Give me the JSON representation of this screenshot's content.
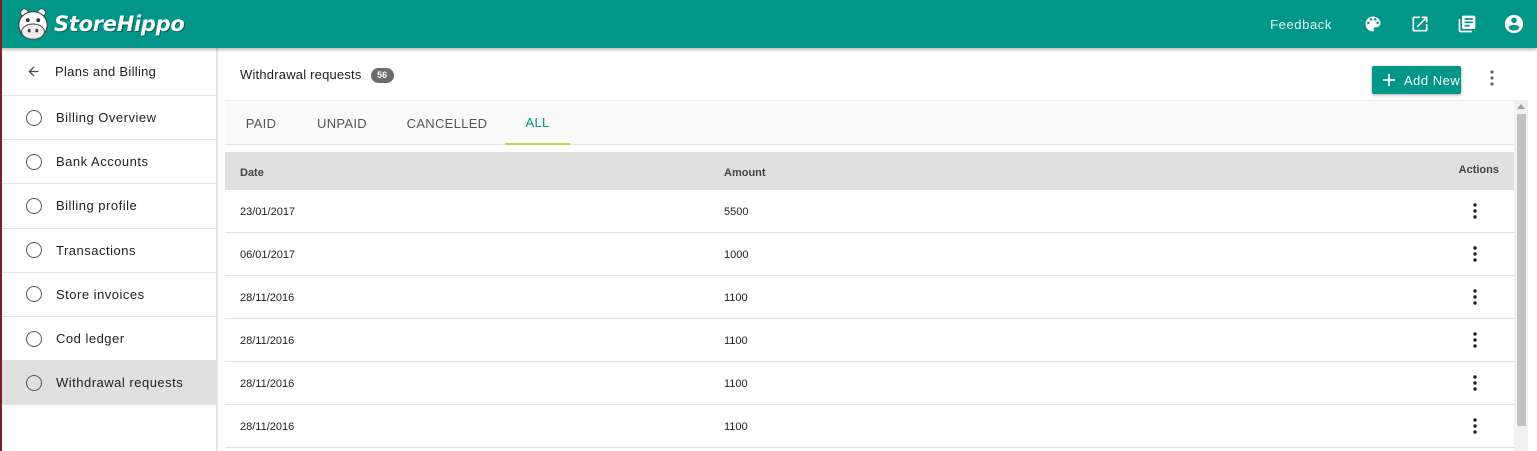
{
  "app": {
    "brand": "StoreHippo",
    "brand_color": "#009688",
    "feedback_label": "Feedback",
    "icons": [
      "palette-icon",
      "open-in-new-icon",
      "library-books-icon",
      "account-circle-icon"
    ]
  },
  "sidebar": {
    "back_label": "Plans and Billing",
    "items": [
      {
        "label": "Billing Overview"
      },
      {
        "label": "Bank Accounts"
      },
      {
        "label": "Billing profile"
      },
      {
        "label": "Transactions"
      },
      {
        "label": "Store invoices"
      },
      {
        "label": "Cod ledger"
      },
      {
        "label": "Withdrawal requests",
        "active": true
      }
    ]
  },
  "main": {
    "title": "Withdrawal requests",
    "count": "56",
    "add_label": "Add New",
    "tabs": [
      {
        "label": "PAID"
      },
      {
        "label": "UNPAID"
      },
      {
        "label": "CANCELLED"
      },
      {
        "label": "ALL",
        "active": true
      }
    ],
    "columns": {
      "date": "Date",
      "amount": "Amount",
      "actions": "Actions"
    },
    "rows": [
      {
        "date": "23/01/2017",
        "amount": "5500"
      },
      {
        "date": "06/01/2017",
        "amount": "1000"
      },
      {
        "date": "28/11/2016",
        "amount": "1100"
      },
      {
        "date": "28/11/2016",
        "amount": "1100"
      },
      {
        "date": "28/11/2016",
        "amount": "1100"
      },
      {
        "date": "28/11/2016",
        "amount": "1100"
      }
    ]
  }
}
